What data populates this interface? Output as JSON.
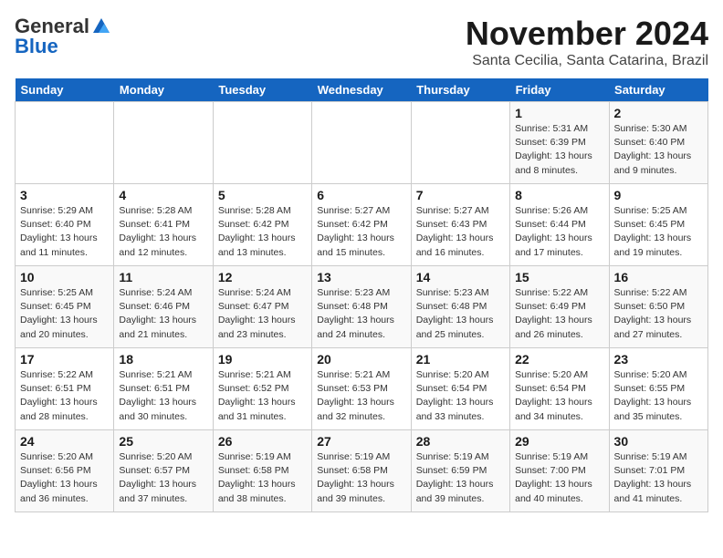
{
  "header": {
    "logo_general": "General",
    "logo_blue": "Blue",
    "month_title": "November 2024",
    "location": "Santa Cecilia, Santa Catarina, Brazil"
  },
  "weekdays": [
    "Sunday",
    "Monday",
    "Tuesday",
    "Wednesday",
    "Thursday",
    "Friday",
    "Saturday"
  ],
  "weeks": [
    [
      {
        "day": "",
        "info": ""
      },
      {
        "day": "",
        "info": ""
      },
      {
        "day": "",
        "info": ""
      },
      {
        "day": "",
        "info": ""
      },
      {
        "day": "",
        "info": ""
      },
      {
        "day": "1",
        "info": "Sunrise: 5:31 AM\nSunset: 6:39 PM\nDaylight: 13 hours and 8 minutes."
      },
      {
        "day": "2",
        "info": "Sunrise: 5:30 AM\nSunset: 6:40 PM\nDaylight: 13 hours and 9 minutes."
      }
    ],
    [
      {
        "day": "3",
        "info": "Sunrise: 5:29 AM\nSunset: 6:40 PM\nDaylight: 13 hours and 11 minutes."
      },
      {
        "day": "4",
        "info": "Sunrise: 5:28 AM\nSunset: 6:41 PM\nDaylight: 13 hours and 12 minutes."
      },
      {
        "day": "5",
        "info": "Sunrise: 5:28 AM\nSunset: 6:42 PM\nDaylight: 13 hours and 13 minutes."
      },
      {
        "day": "6",
        "info": "Sunrise: 5:27 AM\nSunset: 6:42 PM\nDaylight: 13 hours and 15 minutes."
      },
      {
        "day": "7",
        "info": "Sunrise: 5:27 AM\nSunset: 6:43 PM\nDaylight: 13 hours and 16 minutes."
      },
      {
        "day": "8",
        "info": "Sunrise: 5:26 AM\nSunset: 6:44 PM\nDaylight: 13 hours and 17 minutes."
      },
      {
        "day": "9",
        "info": "Sunrise: 5:25 AM\nSunset: 6:45 PM\nDaylight: 13 hours and 19 minutes."
      }
    ],
    [
      {
        "day": "10",
        "info": "Sunrise: 5:25 AM\nSunset: 6:45 PM\nDaylight: 13 hours and 20 minutes."
      },
      {
        "day": "11",
        "info": "Sunrise: 5:24 AM\nSunset: 6:46 PM\nDaylight: 13 hours and 21 minutes."
      },
      {
        "day": "12",
        "info": "Sunrise: 5:24 AM\nSunset: 6:47 PM\nDaylight: 13 hours and 23 minutes."
      },
      {
        "day": "13",
        "info": "Sunrise: 5:23 AM\nSunset: 6:48 PM\nDaylight: 13 hours and 24 minutes."
      },
      {
        "day": "14",
        "info": "Sunrise: 5:23 AM\nSunset: 6:48 PM\nDaylight: 13 hours and 25 minutes."
      },
      {
        "day": "15",
        "info": "Sunrise: 5:22 AM\nSunset: 6:49 PM\nDaylight: 13 hours and 26 minutes."
      },
      {
        "day": "16",
        "info": "Sunrise: 5:22 AM\nSunset: 6:50 PM\nDaylight: 13 hours and 27 minutes."
      }
    ],
    [
      {
        "day": "17",
        "info": "Sunrise: 5:22 AM\nSunset: 6:51 PM\nDaylight: 13 hours and 28 minutes."
      },
      {
        "day": "18",
        "info": "Sunrise: 5:21 AM\nSunset: 6:51 PM\nDaylight: 13 hours and 30 minutes."
      },
      {
        "day": "19",
        "info": "Sunrise: 5:21 AM\nSunset: 6:52 PM\nDaylight: 13 hours and 31 minutes."
      },
      {
        "day": "20",
        "info": "Sunrise: 5:21 AM\nSunset: 6:53 PM\nDaylight: 13 hours and 32 minutes."
      },
      {
        "day": "21",
        "info": "Sunrise: 5:20 AM\nSunset: 6:54 PM\nDaylight: 13 hours and 33 minutes."
      },
      {
        "day": "22",
        "info": "Sunrise: 5:20 AM\nSunset: 6:54 PM\nDaylight: 13 hours and 34 minutes."
      },
      {
        "day": "23",
        "info": "Sunrise: 5:20 AM\nSunset: 6:55 PM\nDaylight: 13 hours and 35 minutes."
      }
    ],
    [
      {
        "day": "24",
        "info": "Sunrise: 5:20 AM\nSunset: 6:56 PM\nDaylight: 13 hours and 36 minutes."
      },
      {
        "day": "25",
        "info": "Sunrise: 5:20 AM\nSunset: 6:57 PM\nDaylight: 13 hours and 37 minutes."
      },
      {
        "day": "26",
        "info": "Sunrise: 5:19 AM\nSunset: 6:58 PM\nDaylight: 13 hours and 38 minutes."
      },
      {
        "day": "27",
        "info": "Sunrise: 5:19 AM\nSunset: 6:58 PM\nDaylight: 13 hours and 39 minutes."
      },
      {
        "day": "28",
        "info": "Sunrise: 5:19 AM\nSunset: 6:59 PM\nDaylight: 13 hours and 39 minutes."
      },
      {
        "day": "29",
        "info": "Sunrise: 5:19 AM\nSunset: 7:00 PM\nDaylight: 13 hours and 40 minutes."
      },
      {
        "day": "30",
        "info": "Sunrise: 5:19 AM\nSunset: 7:01 PM\nDaylight: 13 hours and 41 minutes."
      }
    ]
  ]
}
